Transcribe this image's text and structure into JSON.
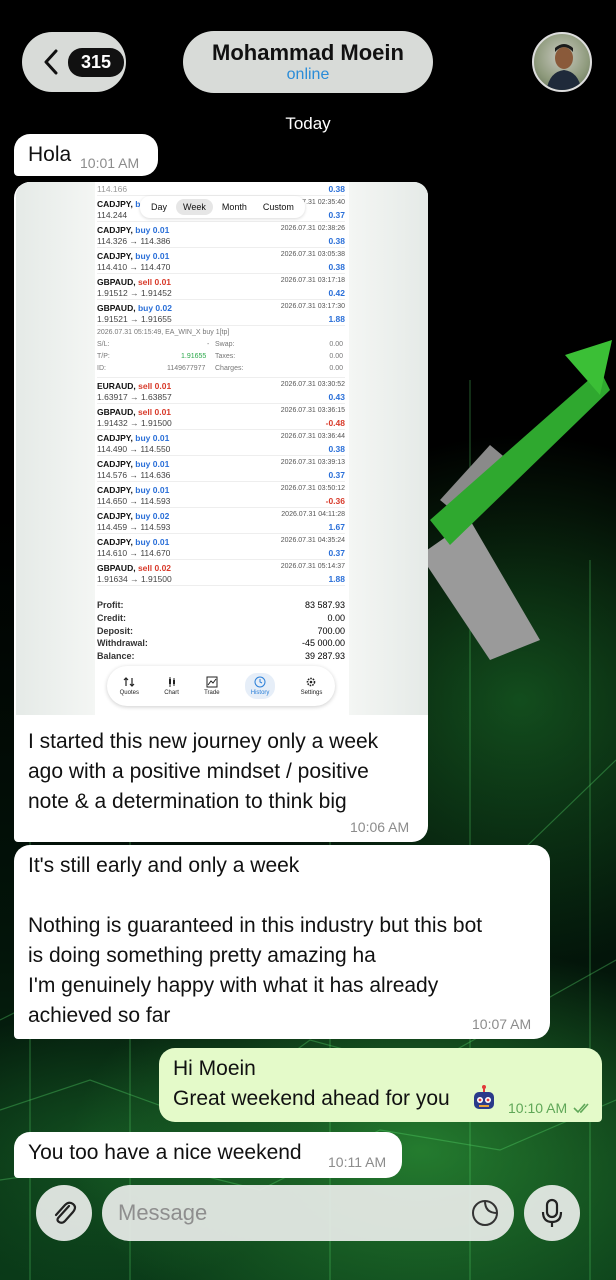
{
  "header": {
    "back_count": "315",
    "contact_name": "Mohammad Moein",
    "status": "online"
  },
  "date_divider": "Today",
  "messages": [
    {
      "text": "Hola",
      "time": "10:01 AM"
    },
    {
      "text": "I started this new journey only a week\nago with a positive mindset / positive\nnote & a determination to think big",
      "time": "10:06 AM"
    },
    {
      "text": "It's still early and only a week\n\nNothing is guaranteed in this industry but this bot\nis doing something pretty amazing ha\nI'm genuinely happy with what it has already\nachieved so far",
      "time": "10:07 AM"
    },
    {
      "text": "Hi Moein\nGreat weekend ahead for you",
      "time": "10:10 AM"
    },
    {
      "text": "You too have a nice weekend",
      "time": "10:11 AM"
    }
  ],
  "screenshot": {
    "tabs": [
      "Day",
      "Week",
      "Month",
      "Custom"
    ],
    "active_tab": "Week",
    "top_partial": {
      "px": "114.166",
      "pl": "0.38"
    },
    "first_row": {
      "sym": "CADJPY,",
      "side": "bu",
      "px": "114.244",
      "dt": "2026.07.31 02:35:40",
      "pl": "0.37"
    },
    "deals_a": [
      {
        "sym": "CADJPY,",
        "side": "buy 0.01",
        "dir": "buy",
        "px": "114.326 → 114.386",
        "dt": "2026.07.31 02:38:26",
        "pl": "0.38"
      },
      {
        "sym": "CADJPY,",
        "side": "buy 0.01",
        "dir": "buy",
        "px": "114.410 → 114.470",
        "dt": "2026.07.31 03:05:38",
        "pl": "0.38"
      },
      {
        "sym": "GBPAUD,",
        "side": "sell 0.01",
        "dir": "sell",
        "px": "1.91512 → 1.91452",
        "dt": "2026.07.31 03:17:18",
        "pl": "0.42"
      },
      {
        "sym": "GBPAUD,",
        "side": "buy 0.02",
        "dir": "buy",
        "px": "1.91521 → 1.91655",
        "dt": "2026.07.31 03:17:30",
        "pl": "1.88"
      }
    ],
    "detail": {
      "line": "2026.07.31 05:15:49, EA_WIN_X buy 1[tp]",
      "sl_label": "S/L:",
      "sl_value": "-",
      "tp_label": "T/P:",
      "tp_value": "1.91655",
      "id_label": "ID:",
      "id_value": "1149677977",
      "swap_label": "Swap:",
      "swap_value": "0.00",
      "taxes_label": "Taxes:",
      "taxes_value": "0.00",
      "charges_label": "Charges:",
      "charges_value": "0.00"
    },
    "deals_b": [
      {
        "sym": "EURAUD,",
        "side": "sell 0.01",
        "dir": "sell",
        "px": "1.63917 → 1.63857",
        "dt": "2026.07.31 03:30:52",
        "pl": "0.43"
      },
      {
        "sym": "GBPAUD,",
        "side": "sell 0.01",
        "dir": "sell",
        "px": "1.91432 → 1.91500",
        "dt": "2026.07.31 03:36:15",
        "pl": "-0.48"
      },
      {
        "sym": "CADJPY,",
        "side": "buy 0.01",
        "dir": "buy",
        "px": "114.490 → 114.550",
        "dt": "2026.07.31 03:36:44",
        "pl": "0.38"
      },
      {
        "sym": "CADJPY,",
        "side": "buy 0.01",
        "dir": "buy",
        "px": "114.576 → 114.636",
        "dt": "2026.07.31 03:39:13",
        "pl": "0.37"
      },
      {
        "sym": "CADJPY,",
        "side": "buy 0.01",
        "dir": "buy",
        "px": "114.650 → 114.593",
        "dt": "2026.07.31 03:50:12",
        "pl": "-0.36"
      },
      {
        "sym": "CADJPY,",
        "side": "buy 0.02",
        "dir": "buy",
        "px": "114.459 → 114.593",
        "dt": "2026.07.31 04:11:28",
        "pl": "1.67"
      },
      {
        "sym": "CADJPY,",
        "side": "buy 0.01",
        "dir": "buy",
        "px": "114.610 → 114.670",
        "dt": "2026.07.31 04:35:24",
        "pl": "0.37"
      },
      {
        "sym": "GBPAUD,",
        "side": "sell 0.02",
        "dir": "sell",
        "px": "1.91634 → 1.91500",
        "dt": "2026.07.31 05:14:37",
        "pl": "1.88"
      }
    ],
    "summary": [
      {
        "label": "Profit:",
        "value": "83 587.93"
      },
      {
        "label": "Credit:",
        "value": "0.00"
      },
      {
        "label": "Deposit:",
        "value": "700.00"
      },
      {
        "label": "Withdrawal:",
        "value": "-45 000.00"
      },
      {
        "label": "Balance:",
        "value": "39 287.93"
      }
    ],
    "nav": [
      "Quotes",
      "Chart",
      "Trade",
      "History",
      "Settings"
    ],
    "nav_active": "History"
  },
  "input": {
    "placeholder": "Message"
  },
  "colors": {
    "outgoing_bubble": "#e4fac9",
    "link_blue": "#2a8cd8",
    "buy_blue": "#2a6fd8",
    "sell_red": "#d83a2a"
  }
}
